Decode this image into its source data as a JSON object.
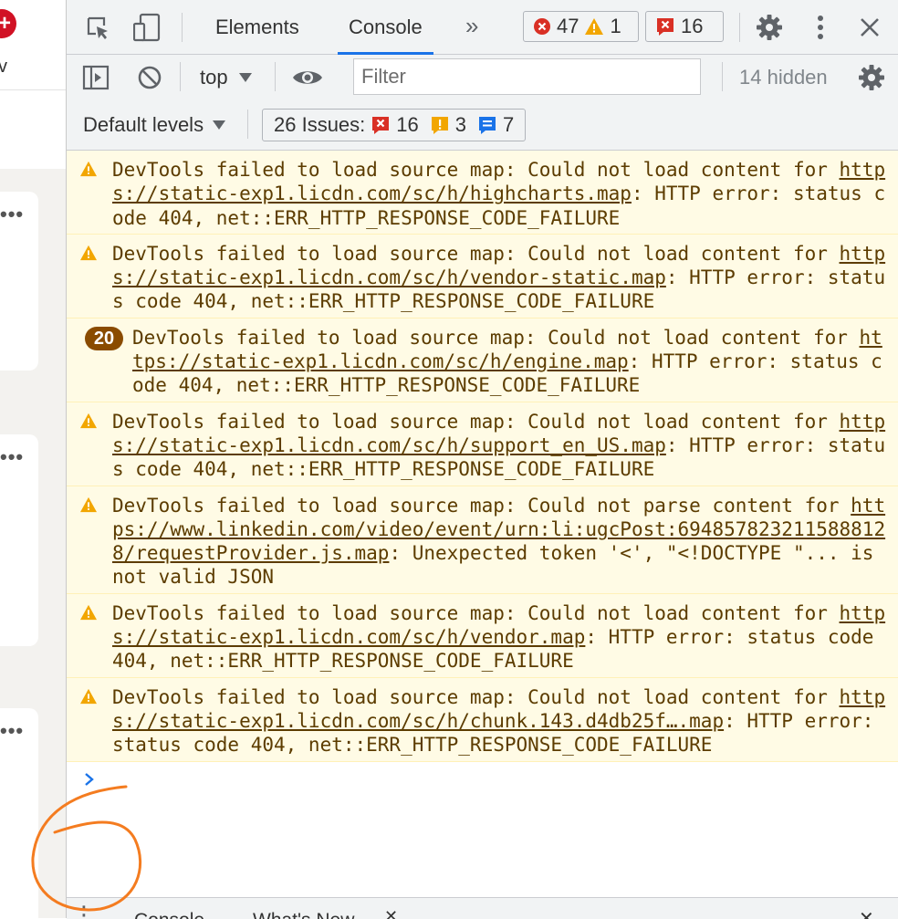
{
  "page": {
    "clipped_letter": "v",
    "more_dots": "•••"
  },
  "devtools": {
    "tabs": [
      {
        "label": "Elements"
      },
      {
        "label": "Console",
        "active": true
      }
    ],
    "more_tabs_glyph": "»",
    "counters": {
      "errors": "47",
      "warnings": "1",
      "issues_errors": "16"
    },
    "toolbar": {
      "context": "top",
      "filter_placeholder": "Filter",
      "hidden_count": "14 hidden",
      "levels": "Default levels",
      "issues_label": "26 Issues:",
      "issues_errors": "16",
      "issues_warnings": "3",
      "issues_info": "7"
    },
    "messages": [
      {
        "type": "warning",
        "pre": "DevTools failed to load source map: Could not load content for ",
        "link": "https://static-exp1.licdn.com/sc/h/highcharts.map",
        "post": ": HTTP error: status code 404, net::ERR_HTTP_RESPONSE_CODE_FAILURE"
      },
      {
        "type": "warning",
        "pre": "DevTools failed to load source map: Could not load content for ",
        "link": "https://static-exp1.licdn.com/sc/h/vendor-static.map",
        "post": ": HTTP error: status code 404, net::ERR_HTTP_RESPONSE_CODE_FAILURE"
      },
      {
        "type": "grouped",
        "count": "20",
        "pre": "DevTools failed to load source map: Could not load content for ",
        "link": "https://static-exp1.licdn.com/sc/h/engine.map",
        "post": ": HTTP error: status code 404, net::ERR_HTTP_RESPONSE_CODE_FAILURE"
      },
      {
        "type": "warning",
        "pre": "DevTools failed to load source map: Could not load content for ",
        "link": "https://static-exp1.licdn.com/sc/h/support_en_US.map",
        "post": ": HTTP error: status code 404, net::ERR_HTTP_RESPONSE_CODE_FAILURE"
      },
      {
        "type": "warning",
        "pre": "DevTools failed to load source map: Could not parse content for ",
        "link": "https://www.linkedin.com/video/event/urn:li:ugcPost:6948578232115888128/requestProvider.js.map",
        "post": ": Unexpected token '<', \"<!DOCTYPE \"... is not valid JSON"
      },
      {
        "type": "warning",
        "pre": "DevTools failed to load source map: Could not load content for ",
        "link": "https://static-exp1.licdn.com/sc/h/vendor.map",
        "post": ": HTTP error: status code 404, net::ERR_HTTP_RESPONSE_CODE_FAILURE"
      },
      {
        "type": "warning",
        "pre": "DevTools failed to load source map: Could not load content for ",
        "link": "https://static-exp1.licdn.com/sc/h/chunk.143.d4db25f….map",
        "post": ": HTTP error: status code 404, net::ERR_HTTP_RESPONSE_CODE_FAILURE"
      }
    ],
    "prompt_glyph": "›",
    "drawer": {
      "tab1": "Console",
      "tab2": "What's New"
    }
  },
  "colors": {
    "accent": "#1a73e8",
    "warning_bg": "#fffbe5",
    "warning_text": "#5c3c00",
    "error_red": "#d93025",
    "annotation": "#f47c20"
  }
}
